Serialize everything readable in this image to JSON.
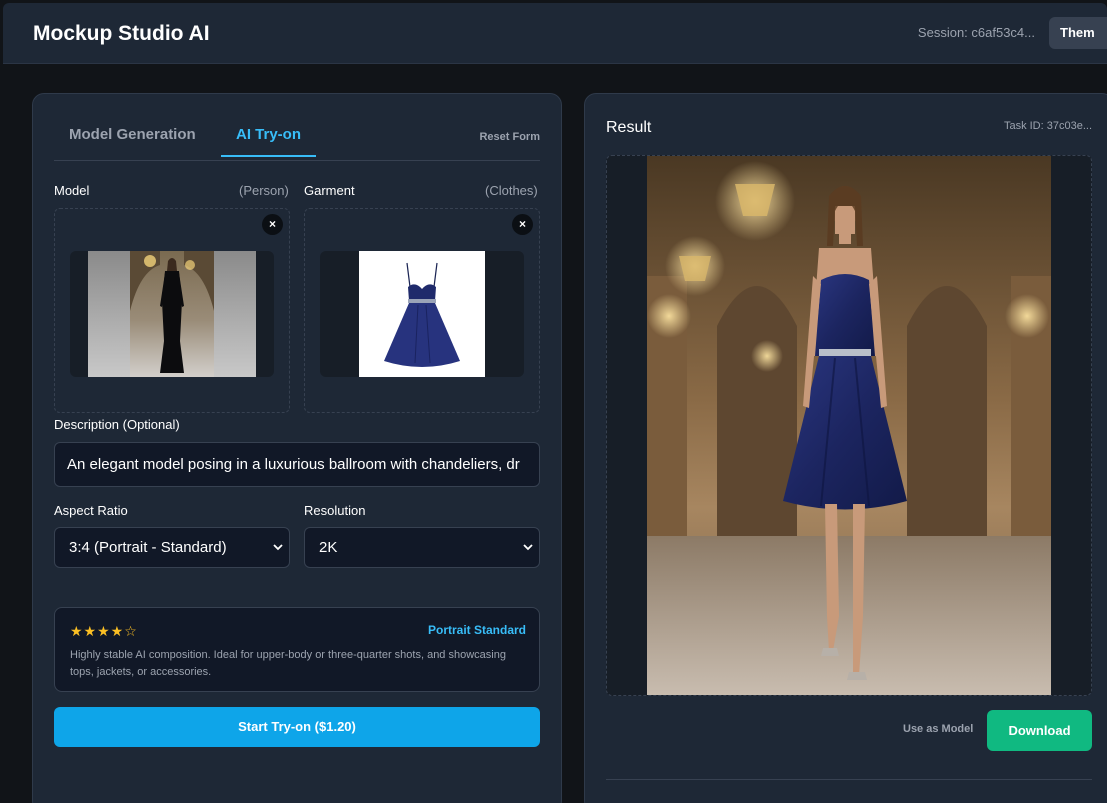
{
  "header": {
    "app_title": "Mockup Studio AI",
    "session": "Session: c6af53c4...",
    "theme_label": "Them"
  },
  "tabs": [
    {
      "label": "Model Generation",
      "active": false
    },
    {
      "label": "AI Try-on",
      "active": true
    }
  ],
  "reset_label": "Reset Form",
  "model_upload": {
    "label": "Model",
    "hint": "(Person)",
    "remove": "×"
  },
  "garment_upload": {
    "label": "Garment",
    "hint": "(Clothes)",
    "remove": "×"
  },
  "description": {
    "label": "Description (Optional)",
    "value": "An elegant model posing in a luxurious ballroom with chandeliers, dr"
  },
  "aspect_ratio": {
    "label": "Aspect Ratio",
    "selected": "3:4 (Portrait - Standard)"
  },
  "resolution": {
    "label": "Resolution",
    "selected": "2K"
  },
  "info_card": {
    "stars": "★★★★☆",
    "tag": "Portrait Standard",
    "text": "Highly stable AI composition. Ideal for upper-body or three-quarter shots, and showcasing tops, jackets, or accessories."
  },
  "start_button": "Start Try-on ($1.20)",
  "result": {
    "title": "Result",
    "task_id": "Task ID: 37c03e...",
    "use_as_model": "Use as Model",
    "download": "Download"
  },
  "colors": {
    "accent": "#0ea5e9",
    "success": "#10b981",
    "panel": "#1e2836",
    "background": "#111418"
  }
}
